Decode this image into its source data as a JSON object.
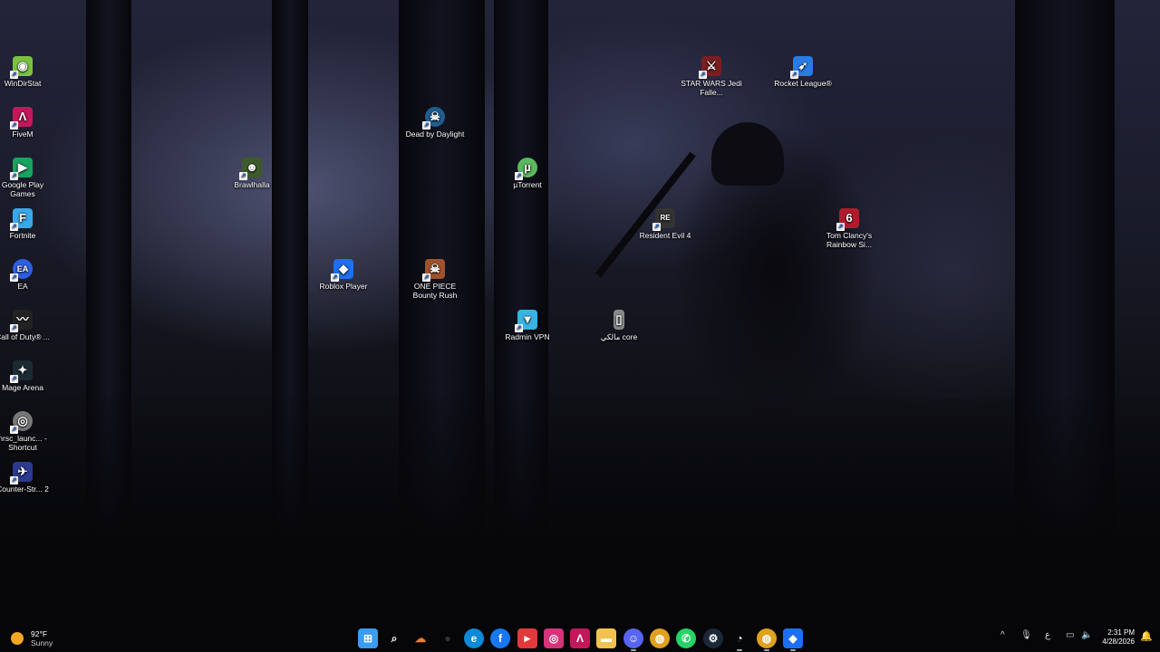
{
  "desktop": {
    "icons": [
      {
        "label": "WinDirStat",
        "icon": "windirstat-icon",
        "color": "#7cc242",
        "glyph": "◉"
      },
      {
        "label": "FiveM",
        "icon": "fivem-icon",
        "color": "#c2185b",
        "glyph": "Λ"
      },
      {
        "label": "Google Play Games",
        "icon": "google-play-games-icon",
        "color": "#1aa260",
        "glyph": "▶"
      },
      {
        "label": "Fortnite",
        "icon": "fortnite-icon",
        "color": "#3aa7e8",
        "glyph": "F"
      },
      {
        "label": "EA",
        "icon": "ea-icon",
        "color": "#2d5fe0",
        "glyph": "EA"
      },
      {
        "label": "Call of Duty® ...",
        "icon": "call-of-duty-icon",
        "color": "#222",
        "glyph": "〰"
      },
      {
        "label": "Mage Arena",
        "icon": "mage-arena-icon",
        "color": "#1b2a33",
        "glyph": "✦"
      },
      {
        "label": "nrsc_launc... - Shortcut",
        "icon": "nrsc-launcher-icon",
        "color": "#777",
        "glyph": "◎"
      },
      {
        "label": "Counter-Str... 2",
        "icon": "counter-strike-2-icon",
        "color": "#2b3a8f",
        "glyph": "✈"
      },
      {
        "label": "Brawlhalla",
        "icon": "brawlhalla-icon",
        "color": "#3d5b2a",
        "glyph": "☻"
      },
      {
        "label": "Roblox Player",
        "icon": "roblox-icon",
        "color": "#1d6ff2",
        "glyph": "◆"
      },
      {
        "label": "Dead by Daylight",
        "icon": "dead-by-daylight-icon",
        "color": "#1f5e8f",
        "glyph": "☠"
      },
      {
        "label": "ONE PIECE Bounty Rush",
        "icon": "one-piece-icon",
        "color": "#a0522d",
        "glyph": "☠"
      },
      {
        "label": "µTorrent",
        "icon": "utorrent-icon",
        "color": "#5cb85c",
        "glyph": "µ"
      },
      {
        "label": "Radmin VPN",
        "icon": "radmin-vpn-icon",
        "color": "#3bb3e0",
        "glyph": "▼"
      },
      {
        "label": "مالكي core",
        "icon": "file-icon",
        "color": "#8a8a8a",
        "glyph": "▯"
      },
      {
        "label": "Resident Evil 4",
        "icon": "resident-evil-4-icon",
        "color": "#333",
        "glyph": "RE"
      },
      {
        "label": "STAR WARS Jedi Falle...",
        "icon": "star-wars-icon",
        "color": "#7a1f1f",
        "glyph": "⚔"
      },
      {
        "label": "Rocket League®",
        "icon": "rocket-league-icon",
        "color": "#2a7be4",
        "glyph": "➶"
      },
      {
        "label": "Tom Clancy's Rainbow Si...",
        "icon": "rainbow-six-icon",
        "color": "#b01c2e",
        "glyph": "6"
      }
    ]
  },
  "taskbar": {
    "weather": {
      "temp": "92°F",
      "condition": "Sunny"
    },
    "apps": [
      {
        "icon": "start-icon",
        "glyph": "⊞",
        "color": "#3b9cf4"
      },
      {
        "icon": "search-icon",
        "glyph": "⌕",
        "color": "transparent"
      },
      {
        "icon": "cloudflare-icon",
        "glyph": "☁",
        "color": "transparent"
      },
      {
        "icon": "obs-icon",
        "glyph": "●",
        "color": "transparent"
      },
      {
        "icon": "edge-icon",
        "glyph": "e",
        "color": "#0c8ad8"
      },
      {
        "icon": "facebook-icon",
        "glyph": "f",
        "color": "#1877f2"
      },
      {
        "icon": "video-app-icon",
        "glyph": "►",
        "color": "#e03a3a"
      },
      {
        "icon": "instagram-icon",
        "glyph": "◎",
        "color": "#d6337a"
      },
      {
        "icon": "fivem-icon",
        "glyph": "Λ",
        "color": "#c2185b"
      },
      {
        "icon": "file-explorer-icon",
        "glyph": "▬",
        "color": "#f2c14e"
      },
      {
        "icon": "discord-icon",
        "glyph": "☺",
        "color": "#5865f2"
      },
      {
        "icon": "chrome-icon",
        "glyph": "◍",
        "color": "#e0a020"
      },
      {
        "icon": "whatsapp-icon",
        "glyph": "✆",
        "color": "#25d366"
      },
      {
        "icon": "steam-icon",
        "glyph": "⚙",
        "color": "#1b2838"
      },
      {
        "icon": "clock-app-icon",
        "glyph": "◔",
        "color": "transparent"
      },
      {
        "icon": "chrome-active-icon",
        "glyph": "◍",
        "color": "#e0a020"
      },
      {
        "icon": "roblox-taskbar-icon",
        "glyph": "◆",
        "color": "#1d6ff2"
      }
    ],
    "tray": {
      "chevron": "^",
      "mic": "🎙",
      "lang": "ع",
      "network": "▭",
      "volume": "🔈"
    },
    "clock": {
      "time": "2:31 PM",
      "date": "4/28/2026"
    }
  }
}
